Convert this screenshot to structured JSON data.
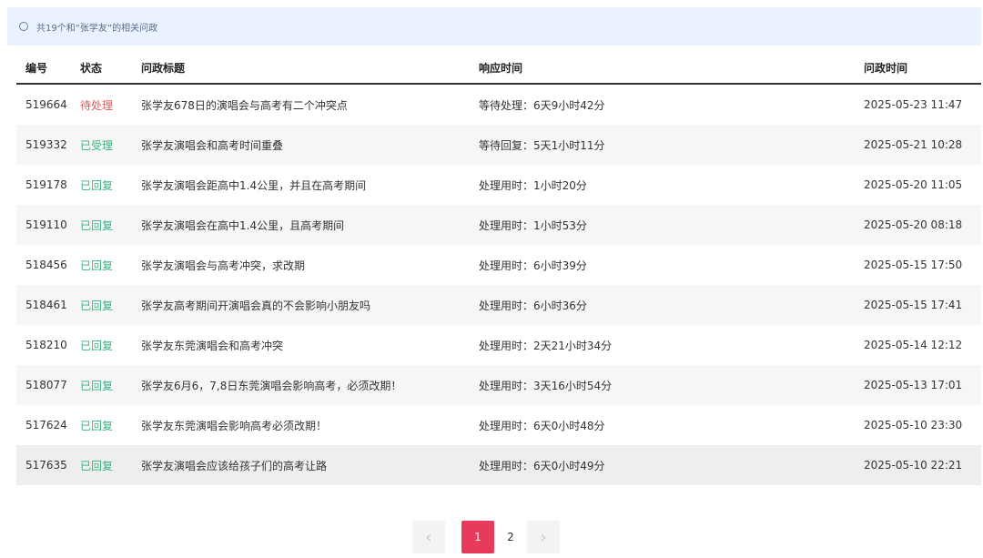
{
  "banner": {
    "text": "共19个和“张学友”的相关问政"
  },
  "table": {
    "headers": {
      "id": "编号",
      "status": "状态",
      "title": "问政标题",
      "response": "响应时间",
      "time": "问政时间"
    },
    "rows": [
      {
        "id": "519664",
        "status": "待处理",
        "title": "张学友678日的演唱会与高考有二个冲突点",
        "response": "等待处理：6天9小时42分",
        "time": "2025-05-23 11:47"
      },
      {
        "id": "519332",
        "status": "已受理",
        "title": "张学友演唱会和高考时间重叠",
        "response": "等待回复：5天1小时11分",
        "time": "2025-05-21 10:28"
      },
      {
        "id": "519178",
        "status": "已回复",
        "title": "张学友演唱会距高中1.4公里，并且在高考期间",
        "response": "处理用时：1小时20分",
        "time": "2025-05-20 11:05"
      },
      {
        "id": "519110",
        "status": "已回复",
        "title": "张学友演唱会在高中1.4公里，且高考期间",
        "response": "处理用时：1小时53分",
        "time": "2025-05-20 08:18"
      },
      {
        "id": "518456",
        "status": "已回复",
        "title": "张学友演唱会与高考冲突，求改期",
        "response": "处理用时：6小时39分",
        "time": "2025-05-15 17:50"
      },
      {
        "id": "518461",
        "status": "已回复",
        "title": "张学友高考期间开演唱会真的不会影响小朋友吗",
        "response": "处理用时：6小时36分",
        "time": "2025-05-15 17:41"
      },
      {
        "id": "518210",
        "status": "已回复",
        "title": "张学友东莞演唱会和高考冲突",
        "response": "处理用时：2天21小时34分",
        "time": "2025-05-14 12:12"
      },
      {
        "id": "518077",
        "status": "已回复",
        "title": "张学友6月6，7,8日东莞演唱会影响高考，必须改期！",
        "response": "处理用时：3天16小时54分",
        "time": "2025-05-13 17:01"
      },
      {
        "id": "517624",
        "status": "已回复",
        "title": "张学友东莞演唱会影响高考必须改期！",
        "response": "处理用时：6天0小时48分",
        "time": "2025-05-10 23:30"
      },
      {
        "id": "517635",
        "status": "已回复",
        "title": "张学友演唱会应该给孩子们的高考让路",
        "response": "处理用时：6天0小时49分",
        "time": "2025-05-10 22:21"
      }
    ]
  },
  "pagination": {
    "prev": "‹",
    "pages": [
      "1",
      "2"
    ],
    "current": "1",
    "next": "›"
  },
  "colors": {
    "pending": "#e05a5a",
    "replied": "#36b37e",
    "active_page": "#e83a5a",
    "banner_bg": "#eaf2ff"
  }
}
